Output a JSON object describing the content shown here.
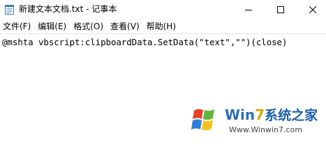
{
  "window": {
    "title": "新建文本文档.txt - 记事本",
    "minimize_glyph": "—",
    "maximize_glyph": "☐",
    "close_glyph": "✕"
  },
  "menu": {
    "items": [
      {
        "label": "文件(F)"
      },
      {
        "label": "编辑(E)"
      },
      {
        "label": "格式(O)"
      },
      {
        "label": "查看(V)"
      },
      {
        "label": "帮助(H)"
      }
    ]
  },
  "editor": {
    "content": "@mshta vbscript:clipboardData.SetData(\"text\",\"\")(close)"
  },
  "watermark": {
    "title_part1": "Win",
    "title_seven": "7",
    "title_part2": "系统之家",
    "url": "Www.Winwin7.com",
    "logo": "windows-flag-logo"
  },
  "colors": {
    "watermark_blue": "#2b6fb6",
    "watermark_gold": "#d9a400"
  }
}
